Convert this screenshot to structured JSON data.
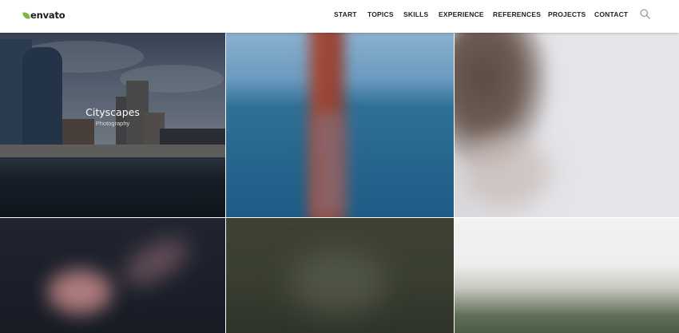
{
  "brand": {
    "name": "envato",
    "leaf_color": "#82b540"
  },
  "nav": {
    "items": [
      {
        "label": "START"
      },
      {
        "label": "TOPICS"
      },
      {
        "label": "SKILLS"
      },
      {
        "label": "EXPERIENCE"
      },
      {
        "label": "REFERENCES"
      },
      {
        "label": "PROJECTS"
      },
      {
        "label": "CONTACT"
      }
    ],
    "search_icon": "search-icon"
  },
  "gallery": {
    "tiles": [
      {
        "title": "Cityscapes",
        "subtitle": "Photography"
      }
    ]
  }
}
